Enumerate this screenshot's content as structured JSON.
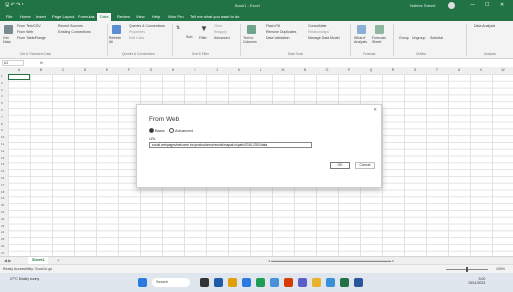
{
  "titlebar": {
    "quick": "🖫 ↶ ↷ ▾",
    "title": "Book1 - Excel",
    "user": "Nafees Saeed",
    "minimize": "—",
    "maximize": "☐",
    "close": "✕"
  },
  "tabs": [
    "File",
    "Home",
    "Insert",
    "Page Layout",
    "Formulas",
    "Data",
    "Review",
    "View",
    "Help",
    "Wiro Pro",
    "Tell me what you want to do"
  ],
  "ribbon": {
    "get_data": "Get Data",
    "from_text": "From Text/CSV",
    "from_web": "From Web",
    "from_table": "From Table/Range",
    "recent": "Recent Sources",
    "existing": "Existing Connections",
    "refresh": "Refresh All",
    "queries": "Queries & Connections",
    "properties": "Properties",
    "edit_links": "Edit Links",
    "sort": "Sort",
    "filter": "Filter",
    "clear": "Clear",
    "reapply": "Reapply",
    "advanced": "Advanced",
    "text_to_cols": "Text to Columns",
    "flash_fill": "Flash Fill",
    "remove_dup": "Remove Duplicates",
    "validation": "Data Validation",
    "consolidate": "Consolidate",
    "relationships": "Relationships",
    "manage_model": "Manage Data Model",
    "whatif": "What-If Analysis",
    "forecast": "Forecast Sheet",
    "group": "Group",
    "ungroup": "Ungroup",
    "subtotal": "Subtotal",
    "data_analysis": "Data Analysis",
    "groups": [
      "Get & Transform Data",
      "Queries & Connections",
      "Sort & Filter",
      "Data Tools",
      "Forecast",
      "Outline",
      "Analysis"
    ]
  },
  "formula_bar": {
    "namebox": "A1",
    "fx": "fx"
  },
  "columns": [
    "A",
    "B",
    "C",
    "D",
    "E",
    "F",
    "G",
    "H",
    "I",
    "J",
    "K",
    "L",
    "M",
    "N",
    "O",
    "P",
    "Q",
    "R",
    "S",
    "T",
    "U",
    "V",
    "W"
  ],
  "rows": [
    "1",
    "2",
    "3",
    "4",
    "5",
    "6",
    "7",
    "8",
    "9",
    "10",
    "11",
    "12",
    "13",
    "14",
    "15",
    "16",
    "17",
    "18",
    "19",
    "20",
    "21",
    "22",
    "23",
    "24",
    "25",
    "26",
    "27"
  ],
  "dialog": {
    "title": "From Web",
    "radio_basic": "Basic",
    "radio_advanced": "Advanced",
    "url_label": "URL",
    "url_value": "social.webpages/welcome.inc/product/area/results/mapak.in/path/2016-2020/data",
    "ok": "OK",
    "cancel": "Cancel",
    "close": "✕"
  },
  "sheet": {
    "tab": "Sheet1",
    "add": "+"
  },
  "status": {
    "text": "Ready   Accessibility: Good to go",
    "zoom": "100%"
  },
  "taskbar": {
    "weather": "27°C Mostly sunny",
    "search": "Search",
    "time": "3:00",
    "date": "15/11/2023"
  },
  "colors": {
    "brand": "#217346",
    "selection": "#217346",
    "taskbar": "#dfe6ee"
  }
}
